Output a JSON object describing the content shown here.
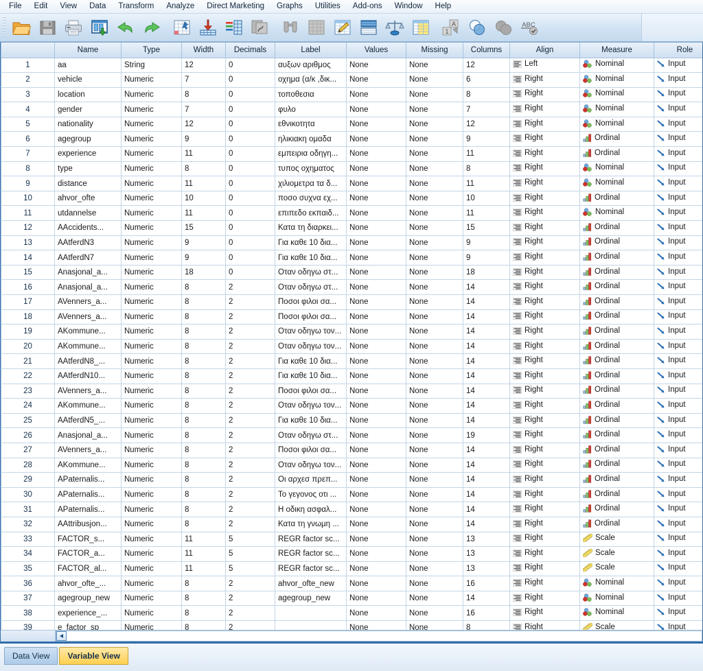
{
  "app": {
    "title": "IBM SPSS Statistics Data Editor - Variable View"
  },
  "menu": {
    "items": [
      {
        "label": "File",
        "accel": "F"
      },
      {
        "label": "Edit",
        "accel": "E"
      },
      {
        "label": "View",
        "accel": "V"
      },
      {
        "label": "Data",
        "accel": "D"
      },
      {
        "label": "Transform",
        "accel": "T"
      },
      {
        "label": "Analyze",
        "accel": "A"
      },
      {
        "label": "Direct Marketing",
        "accel": "M"
      },
      {
        "label": "Graphs",
        "accel": "G"
      },
      {
        "label": "Utilities",
        "accel": "U"
      },
      {
        "label": "Add-ons",
        "accel": "o"
      },
      {
        "label": "Window",
        "accel": "W"
      },
      {
        "label": "Help",
        "accel": "H"
      }
    ]
  },
  "toolbar": {
    "buttons": [
      {
        "name": "open-file-icon",
        "tooltip": "Open data document"
      },
      {
        "name": "save-icon",
        "tooltip": "Save this document"
      },
      {
        "name": "print-icon",
        "tooltip": "Print"
      },
      {
        "name": "recall-dialogs-icon",
        "tooltip": "Recall recently used dialogs"
      },
      {
        "name": "undo-icon",
        "tooltip": "Undo a user action"
      },
      {
        "name": "redo-icon",
        "tooltip": "Redo a user action"
      },
      {
        "name": "goto-case-icon",
        "tooltip": "Go to case"
      },
      {
        "name": "goto-variable-icon",
        "tooltip": "Go to variable"
      },
      {
        "name": "variables-icon",
        "tooltip": "Variables"
      },
      {
        "name": "run-descriptives-icon",
        "tooltip": "Run descriptive statistics"
      },
      {
        "name": "find-icon",
        "tooltip": "Find"
      },
      {
        "name": "insert-cases-icon",
        "tooltip": "Insert cases"
      },
      {
        "name": "insert-variable-icon",
        "tooltip": "Insert variable"
      },
      {
        "name": "split-file-icon",
        "tooltip": "Split file"
      },
      {
        "name": "weight-cases-icon",
        "tooltip": "Weight cases"
      },
      {
        "name": "select-cases-icon",
        "tooltip": "Select cases"
      },
      {
        "name": "value-labels-icon",
        "tooltip": "Value labels"
      },
      {
        "name": "use-variable-sets-icon",
        "tooltip": "Use variable sets"
      },
      {
        "name": "show-all-variables-icon",
        "tooltip": "Show all variables"
      },
      {
        "name": "spell-check-icon",
        "tooltip": "Spell check"
      }
    ]
  },
  "grid": {
    "columns": [
      "Name",
      "Type",
      "Width",
      "Decimals",
      "Label",
      "Values",
      "Missing",
      "Columns",
      "Align",
      "Measure",
      "Role"
    ],
    "rows": [
      {
        "n": "1",
        "name": "aa",
        "type": "String",
        "width": "12",
        "decimals": "0",
        "label": "αυξων αριθμος",
        "values": "None",
        "missing": "None",
        "columns": "12",
        "align": "Left",
        "measure": "Nominal",
        "role": "Input"
      },
      {
        "n": "2",
        "name": "vehicle",
        "type": "Numeric",
        "width": "7",
        "decimals": "0",
        "label": "οχημα (α/κ ,δικ...",
        "values": "None",
        "missing": "None",
        "columns": "6",
        "align": "Right",
        "measure": "Nominal",
        "role": "Input"
      },
      {
        "n": "3",
        "name": "location",
        "type": "Numeric",
        "width": "8",
        "decimals": "0",
        "label": "τοποθεσια",
        "values": "None",
        "missing": "None",
        "columns": "8",
        "align": "Right",
        "measure": "Nominal",
        "role": "Input"
      },
      {
        "n": "4",
        "name": "gender",
        "type": "Numeric",
        "width": "7",
        "decimals": "0",
        "label": "φυλο",
        "values": "None",
        "missing": "None",
        "columns": "7",
        "align": "Right",
        "measure": "Nominal",
        "role": "Input"
      },
      {
        "n": "5",
        "name": "nationality",
        "type": "Numeric",
        "width": "12",
        "decimals": "0",
        "label": "εθνικοτητα",
        "values": "None",
        "missing": "None",
        "columns": "12",
        "align": "Right",
        "measure": "Nominal",
        "role": "Input"
      },
      {
        "n": "6",
        "name": "agegroup",
        "type": "Numeric",
        "width": "9",
        "decimals": "0",
        "label": "ηλικιακη ομαδα",
        "values": "None",
        "missing": "None",
        "columns": "9",
        "align": "Right",
        "measure": "Ordinal",
        "role": "Input"
      },
      {
        "n": "7",
        "name": "experience",
        "type": "Numeric",
        "width": "11",
        "decimals": "0",
        "label": "εμπειρια οδηγη...",
        "values": "None",
        "missing": "None",
        "columns": "11",
        "align": "Right",
        "measure": "Ordinal",
        "role": "Input"
      },
      {
        "n": "8",
        "name": "type",
        "type": "Numeric",
        "width": "8",
        "decimals": "0",
        "label": "τυπος οχηματος",
        "values": "None",
        "missing": "None",
        "columns": "8",
        "align": "Right",
        "measure": "Nominal",
        "role": "Input"
      },
      {
        "n": "9",
        "name": "distance",
        "type": "Numeric",
        "width": "11",
        "decimals": "0",
        "label": "χιλιομετρα τα δ...",
        "values": "None",
        "missing": "None",
        "columns": "11",
        "align": "Right",
        "measure": "Nominal",
        "role": "Input"
      },
      {
        "n": "10",
        "name": "ahvor_ofte",
        "type": "Numeric",
        "width": "10",
        "decimals": "0",
        "label": "ποσο συχνα εχ...",
        "values": "None",
        "missing": "None",
        "columns": "10",
        "align": "Right",
        "measure": "Ordinal",
        "role": "Input"
      },
      {
        "n": "11",
        "name": "utdannelse",
        "type": "Numeric",
        "width": "11",
        "decimals": "0",
        "label": "επιπεδο εκπαιδ...",
        "values": "None",
        "missing": "None",
        "columns": "11",
        "align": "Right",
        "measure": "Nominal",
        "role": "Input"
      },
      {
        "n": "12",
        "name": "AAccidents...",
        "type": "Numeric",
        "width": "15",
        "decimals": "0",
        "label": "Κατα τη διαρκει...",
        "values": "None",
        "missing": "None",
        "columns": "15",
        "align": "Right",
        "measure": "Ordinal",
        "role": "Input"
      },
      {
        "n": "13",
        "name": "AAtferdN3",
        "type": "Numeric",
        "width": "9",
        "decimals": "0",
        "label": "Για καθε 10 δια...",
        "values": "None",
        "missing": "None",
        "columns": "9",
        "align": "Right",
        "measure": "Ordinal",
        "role": "Input"
      },
      {
        "n": "14",
        "name": "AAtferdN7",
        "type": "Numeric",
        "width": "9",
        "decimals": "0",
        "label": "Για καθε 10 δια...",
        "values": "None",
        "missing": "None",
        "columns": "9",
        "align": "Right",
        "measure": "Ordinal",
        "role": "Input"
      },
      {
        "n": "15",
        "name": "Anasjonal_a...",
        "type": "Numeric",
        "width": "18",
        "decimals": "0",
        "label": "Οταν οδηγω στ...",
        "values": "None",
        "missing": "None",
        "columns": "18",
        "align": "Right",
        "measure": "Ordinal",
        "role": "Input"
      },
      {
        "n": "16",
        "name": "Anasjonal_a...",
        "type": "Numeric",
        "width": "8",
        "decimals": "2",
        "label": "Οταν οδηγω στ...",
        "values": "None",
        "missing": "None",
        "columns": "14",
        "align": "Right",
        "measure": "Ordinal",
        "role": "Input"
      },
      {
        "n": "17",
        "name": "AVenners_a...",
        "type": "Numeric",
        "width": "8",
        "decimals": "2",
        "label": "Ποσοι φιλοι σα...",
        "values": "None",
        "missing": "None",
        "columns": "14",
        "align": "Right",
        "measure": "Ordinal",
        "role": "Input"
      },
      {
        "n": "18",
        "name": "AVenners_a...",
        "type": "Numeric",
        "width": "8",
        "decimals": "2",
        "label": "Ποσοι φιλοι σα...",
        "values": "None",
        "missing": "None",
        "columns": "14",
        "align": "Right",
        "measure": "Ordinal",
        "role": "Input"
      },
      {
        "n": "19",
        "name": "AKommune...",
        "type": "Numeric",
        "width": "8",
        "decimals": "2",
        "label": "Οταν οδηγω τον...",
        "values": "None",
        "missing": "None",
        "columns": "14",
        "align": "Right",
        "measure": "Ordinal",
        "role": "Input"
      },
      {
        "n": "20",
        "name": "AKommune...",
        "type": "Numeric",
        "width": "8",
        "decimals": "2",
        "label": "Οταν οδηγω τον...",
        "values": "None",
        "missing": "None",
        "columns": "14",
        "align": "Right",
        "measure": "Ordinal",
        "role": "Input"
      },
      {
        "n": "21",
        "name": "AAtferdN8_...",
        "type": "Numeric",
        "width": "8",
        "decimals": "2",
        "label": "Για καθε 10 δια...",
        "values": "None",
        "missing": "None",
        "columns": "14",
        "align": "Right",
        "measure": "Ordinal",
        "role": "Input"
      },
      {
        "n": "22",
        "name": "AAtferdN10...",
        "type": "Numeric",
        "width": "8",
        "decimals": "2",
        "label": "Για καθε 10 δια...",
        "values": "None",
        "missing": "None",
        "columns": "14",
        "align": "Right",
        "measure": "Ordinal",
        "role": "Input"
      },
      {
        "n": "23",
        "name": "AVenners_a...",
        "type": "Numeric",
        "width": "8",
        "decimals": "2",
        "label": "Ποσοι φιλοι σα...",
        "values": "None",
        "missing": "None",
        "columns": "14",
        "align": "Right",
        "measure": "Ordinal",
        "role": "Input"
      },
      {
        "n": "24",
        "name": "AKommune...",
        "type": "Numeric",
        "width": "8",
        "decimals": "2",
        "label": "Οταν οδηγω τον...",
        "values": "None",
        "missing": "None",
        "columns": "14",
        "align": "Right",
        "measure": "Ordinal",
        "role": "Input"
      },
      {
        "n": "25",
        "name": "AAtferdN5_...",
        "type": "Numeric",
        "width": "8",
        "decimals": "2",
        "label": "Για καθε 10 δια...",
        "values": "None",
        "missing": "None",
        "columns": "14",
        "align": "Right",
        "measure": "Ordinal",
        "role": "Input"
      },
      {
        "n": "26",
        "name": "Anasjonal_a...",
        "type": "Numeric",
        "width": "8",
        "decimals": "2",
        "label": "Οταν οδηγω στ...",
        "values": "None",
        "missing": "None",
        "columns": "19",
        "align": "Right",
        "measure": "Ordinal",
        "role": "Input"
      },
      {
        "n": "27",
        "name": "AVenners_a...",
        "type": "Numeric",
        "width": "8",
        "decimals": "2",
        "label": "Ποσοι φιλοι σα...",
        "values": "None",
        "missing": "None",
        "columns": "14",
        "align": "Right",
        "measure": "Ordinal",
        "role": "Input"
      },
      {
        "n": "28",
        "name": "AKommune...",
        "type": "Numeric",
        "width": "8",
        "decimals": "2",
        "label": "Οταν οδηγω τον...",
        "values": "None",
        "missing": "None",
        "columns": "14",
        "align": "Right",
        "measure": "Ordinal",
        "role": "Input"
      },
      {
        "n": "29",
        "name": "APaternalis...",
        "type": "Numeric",
        "width": "8",
        "decimals": "2",
        "label": "Οι αρχεσ πρεπ...",
        "values": "None",
        "missing": "None",
        "columns": "14",
        "align": "Right",
        "measure": "Ordinal",
        "role": "Input"
      },
      {
        "n": "30",
        "name": "APaternalis...",
        "type": "Numeric",
        "width": "8",
        "decimals": "2",
        "label": "Το γεγονος οτι ...",
        "values": "None",
        "missing": "None",
        "columns": "14",
        "align": "Right",
        "measure": "Ordinal",
        "role": "Input"
      },
      {
        "n": "31",
        "name": "APaternalis...",
        "type": "Numeric",
        "width": "8",
        "decimals": "2",
        "label": "Η οδικη ασφαλ...",
        "values": "None",
        "missing": "None",
        "columns": "14",
        "align": "Right",
        "measure": "Ordinal",
        "role": "Input"
      },
      {
        "n": "32",
        "name": "AAttribusjon...",
        "type": "Numeric",
        "width": "8",
        "decimals": "2",
        "label": "Κατα τη γνωμη ...",
        "values": "None",
        "missing": "None",
        "columns": "14",
        "align": "Right",
        "measure": "Ordinal",
        "role": "Input"
      },
      {
        "n": "33",
        "name": "FACTOR_s...",
        "type": "Numeric",
        "width": "11",
        "decimals": "5",
        "label": "REGR factor sc...",
        "values": "None",
        "missing": "None",
        "columns": "13",
        "align": "Right",
        "measure": "Scale",
        "role": "Input"
      },
      {
        "n": "34",
        "name": "FACTOR_a...",
        "type": "Numeric",
        "width": "11",
        "decimals": "5",
        "label": "REGR factor sc...",
        "values": "None",
        "missing": "None",
        "columns": "13",
        "align": "Right",
        "measure": "Scale",
        "role": "Input"
      },
      {
        "n": "35",
        "name": "FACTOR_al...",
        "type": "Numeric",
        "width": "11",
        "decimals": "5",
        "label": "REGR factor sc...",
        "values": "None",
        "missing": "None",
        "columns": "13",
        "align": "Right",
        "measure": "Scale",
        "role": "Input"
      },
      {
        "n": "36",
        "name": "ahvor_ofte_...",
        "type": "Numeric",
        "width": "8",
        "decimals": "2",
        "label": "ahvor_ofte_new",
        "values": "None",
        "missing": "None",
        "columns": "16",
        "align": "Right",
        "measure": "Nominal",
        "role": "Input"
      },
      {
        "n": "37",
        "name": "agegroup_new",
        "type": "Numeric",
        "width": "8",
        "decimals": "2",
        "label": "agegroup_new",
        "values": "None",
        "missing": "None",
        "columns": "14",
        "align": "Right",
        "measure": "Nominal",
        "role": "Input"
      },
      {
        "n": "38",
        "name": "experience_...",
        "type": "Numeric",
        "width": "8",
        "decimals": "2",
        "label": "",
        "values": "None",
        "missing": "None",
        "columns": "16",
        "align": "Right",
        "measure": "Nominal",
        "role": "Input"
      },
      {
        "n": "39",
        "name": "e_factor_sp",
        "type": "Numeric",
        "width": "8",
        "decimals": "2",
        "label": "",
        "values": "None",
        "missing": "None",
        "columns": "8",
        "align": "Right",
        "measure": "Scale",
        "role": "Input"
      }
    ]
  },
  "scrollbar": {
    "left_arrow": "◄"
  },
  "tabs": [
    {
      "label": "Data View",
      "active": false
    },
    {
      "label": "Variable View",
      "active": true
    }
  ],
  "colors": {
    "header_bg": "#d6e4f2",
    "rownum_bg": "#d8e6f4",
    "grid_line": "#c3d5e6",
    "active_tab": "#ffcf4f",
    "inactive_tab": "#aecbe8",
    "accent_border": "#2e6ba8"
  }
}
